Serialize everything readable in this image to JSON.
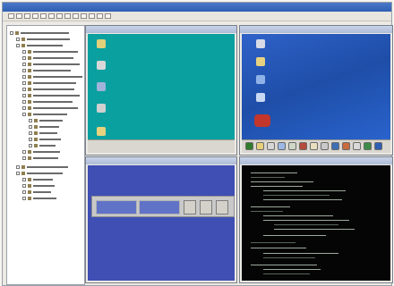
{
  "window": {
    "title": "",
    "accent": "#2f5fb4"
  },
  "tree": {
    "items": []
  },
  "panes": {
    "vm1": {
      "theme": "teal-desktop",
      "color": "#0aa0a0"
    },
    "vm2": {
      "theme": "xp-desktop",
      "color": "#2b66d2"
    },
    "vm3": {
      "theme": "blue-desktop",
      "color": "#3f4fb3"
    },
    "vm4": {
      "theme": "terminal",
      "color": "#050505"
    }
  },
  "icons": {
    "toolbar": [
      "back-icon",
      "forward-icon",
      "stop-icon",
      "refresh-icon",
      "home-icon",
      "search-icon",
      "favorites-icon",
      "history-icon",
      "mail-icon",
      "print-icon",
      "edit-icon",
      "discuss-icon",
      "settings-icon"
    ],
    "vm2_tools": [
      "start-icon",
      "folder-icon",
      "computer-icon",
      "network-icon",
      "recycle-bin-icon",
      "browser-icon",
      "help-icon",
      "search-icon",
      "run-icon",
      "settings-icon",
      "printer-icon",
      "clock-icon",
      "sound-icon"
    ]
  }
}
